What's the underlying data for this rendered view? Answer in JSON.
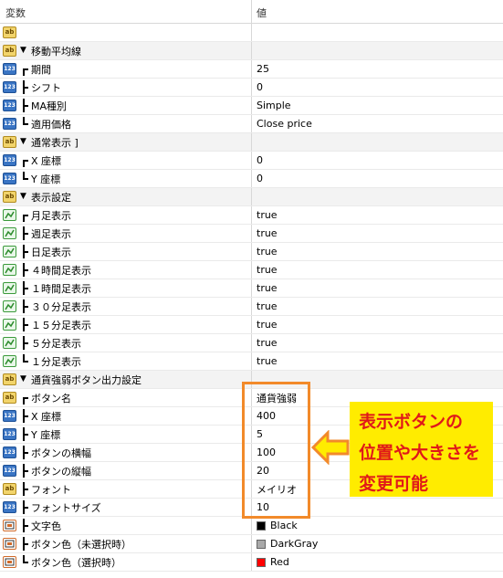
{
  "header": {
    "col_name": "変数",
    "col_value": "値"
  },
  "rows": [
    {
      "icon": "ab",
      "tree": "",
      "name": "",
      "value": "",
      "group": false
    },
    {
      "icon": "ab",
      "tree": "tri",
      "name": "移動平均線",
      "value": "",
      "group": true
    },
    {
      "icon": "n123",
      "tree": "top",
      "name": "期間",
      "value": "25",
      "group": false
    },
    {
      "icon": "n123",
      "tree": "mid",
      "name": "シフト",
      "value": "0",
      "group": false
    },
    {
      "icon": "n123",
      "tree": "mid",
      "name": "MA種別",
      "value": "Simple",
      "group": false
    },
    {
      "icon": "n123",
      "tree": "bot",
      "name": "適用価格",
      "value": "Close price",
      "group": false
    },
    {
      "icon": "ab",
      "tree": "tri",
      "name": "通常表示 ]",
      "value": "",
      "group": true
    },
    {
      "icon": "n123",
      "tree": "top",
      "name": "X 座標",
      "value": "0",
      "group": false
    },
    {
      "icon": "n123",
      "tree": "bot",
      "name": "Y 座標",
      "value": "0",
      "group": false
    },
    {
      "icon": "ab",
      "tree": "tri",
      "name": "表示設定",
      "value": "",
      "group": true
    },
    {
      "icon": "bool",
      "tree": "top",
      "name": "月足表示",
      "value": "true",
      "group": false
    },
    {
      "icon": "bool",
      "tree": "mid",
      "name": "週足表示",
      "value": "true",
      "group": false
    },
    {
      "icon": "bool",
      "tree": "mid",
      "name": "日足表示",
      "value": "true",
      "group": false
    },
    {
      "icon": "bool",
      "tree": "mid",
      "name": "４時間足表示",
      "value": "true",
      "group": false
    },
    {
      "icon": "bool",
      "tree": "mid",
      "name": "１時間足表示",
      "value": "true",
      "group": false
    },
    {
      "icon": "bool",
      "tree": "mid",
      "name": "３０分足表示",
      "value": "true",
      "group": false
    },
    {
      "icon": "bool",
      "tree": "mid",
      "name": "１５分足表示",
      "value": "true",
      "group": false
    },
    {
      "icon": "bool",
      "tree": "mid",
      "name": "５分足表示",
      "value": "true",
      "group": false
    },
    {
      "icon": "bool",
      "tree": "bot",
      "name": "１分足表示",
      "value": "true",
      "group": false
    },
    {
      "icon": "ab",
      "tree": "tri",
      "name": "通貨強弱ボタン出力設定",
      "value": "",
      "group": true
    },
    {
      "icon": "ab",
      "tree": "top",
      "name": "ボタン名",
      "value": "通貨強弱",
      "group": false
    },
    {
      "icon": "n123",
      "tree": "mid",
      "name": "X 座標",
      "value": "400",
      "group": false
    },
    {
      "icon": "n123",
      "tree": "mid",
      "name": "Y 座標",
      "value": "5",
      "group": false
    },
    {
      "icon": "n123",
      "tree": "mid",
      "name": "ボタンの横幅",
      "value": "100",
      "group": false
    },
    {
      "icon": "n123",
      "tree": "mid",
      "name": "ボタンの縦幅",
      "value": "20",
      "group": false
    },
    {
      "icon": "ab",
      "tree": "mid",
      "name": "フォント",
      "value": "メイリオ",
      "group": false
    },
    {
      "icon": "n123",
      "tree": "mid",
      "name": "フォントサイズ",
      "value": "10",
      "group": false
    },
    {
      "icon": "clr",
      "tree": "mid",
      "name": "文字色",
      "value": "Black",
      "swatch": "#000000",
      "group": false
    },
    {
      "icon": "clr",
      "tree": "mid",
      "name": "ボタン色（未選択時）",
      "value": "DarkGray",
      "swatch": "#a9a9a9",
      "group": false
    },
    {
      "icon": "clr",
      "tree": "bot",
      "name": "ボタン色（選択時）",
      "value": "Red",
      "swatch": "#ff0000",
      "group": false
    }
  ],
  "callout": {
    "line1": "表示ボタンの",
    "line2": "位置や大きさを",
    "line3": "変更可能"
  },
  "colors": {
    "highlight": "#f28a2a",
    "callout_bg": "#ffec00",
    "callout_text": "#e01919"
  }
}
